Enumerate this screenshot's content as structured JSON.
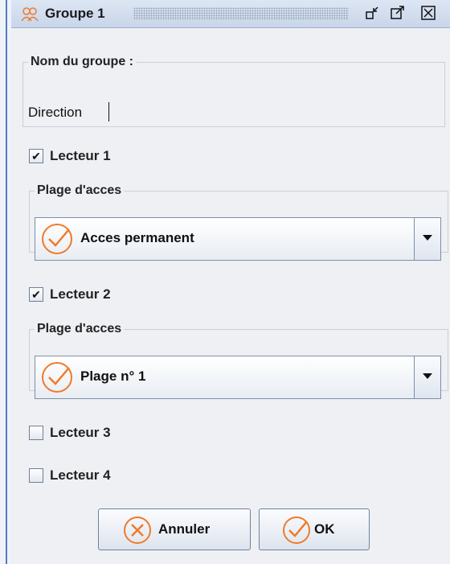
{
  "window": {
    "title": "Groupe 1"
  },
  "name_field": {
    "legend": "Nom du groupe :",
    "value": "Direction"
  },
  "readers": [
    {
      "label": "Lecteur 1",
      "checked": true,
      "plage_legend": "Plage d'acces",
      "plage_value": "Acces permanent"
    },
    {
      "label": "Lecteur 2",
      "checked": true,
      "plage_legend": "Plage d'acces",
      "plage_value": "Plage n° 1"
    },
    {
      "label": "Lecteur 3",
      "checked": false
    },
    {
      "label": "Lecteur 4",
      "checked": false
    }
  ],
  "buttons": {
    "cancel": "Annuler",
    "ok": "OK"
  },
  "icons": {
    "title": "group-icon",
    "minimize": "minimize-icon",
    "maximize": "maximize-icon",
    "close": "close-icon",
    "combo_item": "check-circle-icon",
    "cancel": "x-circle-icon",
    "ok": "check-circle-icon",
    "dropdown": "chevron-down-icon"
  },
  "colors": {
    "accent": "#f07a2a",
    "title_bar": "#c8d6ea",
    "border": "#7d8ea8"
  }
}
